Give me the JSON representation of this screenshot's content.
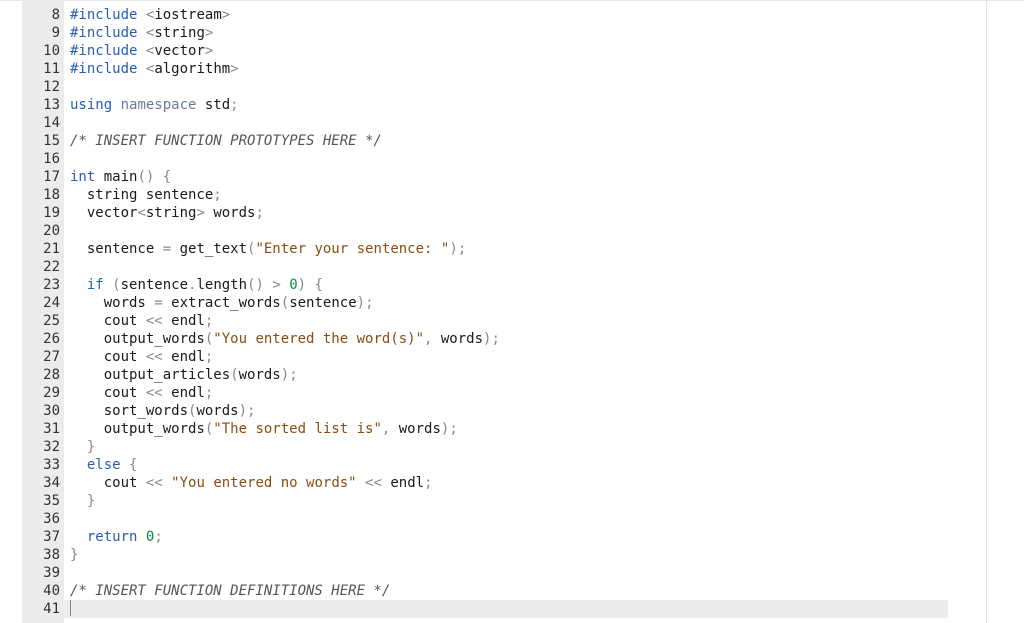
{
  "editor": {
    "lines": [
      {
        "n": "8",
        "t": "#include <iostream>"
      },
      {
        "n": "9",
        "t": "#include <string>"
      },
      {
        "n": "10",
        "t": "#include <vector>"
      },
      {
        "n": "11",
        "t": "#include <algorithm>"
      },
      {
        "n": "12",
        "t": ""
      },
      {
        "n": "13",
        "t": "using namespace std;"
      },
      {
        "n": "14",
        "t": ""
      },
      {
        "n": "15",
        "t": "/* INSERT FUNCTION PROTOTYPES HERE */"
      },
      {
        "n": "16",
        "t": ""
      },
      {
        "n": "17",
        "t": "int main() {"
      },
      {
        "n": "18",
        "t": "  string sentence;"
      },
      {
        "n": "19",
        "t": "  vector<string> words;"
      },
      {
        "n": "20",
        "t": ""
      },
      {
        "n": "21",
        "t": "  sentence = get_text(\"Enter your sentence: \");"
      },
      {
        "n": "22",
        "t": ""
      },
      {
        "n": "23",
        "t": "  if (sentence.length() > 0) {"
      },
      {
        "n": "24",
        "t": "    words = extract_words(sentence);"
      },
      {
        "n": "25",
        "t": "    cout << endl;"
      },
      {
        "n": "26",
        "t": "    output_words(\"You entered the word(s)\", words);"
      },
      {
        "n": "27",
        "t": "    cout << endl;"
      },
      {
        "n": "28",
        "t": "    output_articles(words);"
      },
      {
        "n": "29",
        "t": "    cout << endl;"
      },
      {
        "n": "30",
        "t": "    sort_words(words);"
      },
      {
        "n": "31",
        "t": "    output_words(\"The sorted list is\", words);"
      },
      {
        "n": "32",
        "t": "  }"
      },
      {
        "n": "33",
        "t": "  else {"
      },
      {
        "n": "34",
        "t": "    cout << \"You entered no words\" << endl;"
      },
      {
        "n": "35",
        "t": "  }"
      },
      {
        "n": "36",
        "t": ""
      },
      {
        "n": "37",
        "t": "  return 0;"
      },
      {
        "n": "38",
        "t": "}"
      },
      {
        "n": "39",
        "t": ""
      },
      {
        "n": "40",
        "t": "/* INSERT FUNCTION DEFINITIONS HERE */"
      },
      {
        "n": "41",
        "t": ""
      }
    ],
    "active_line": "41",
    "colors": {
      "keyword": "#2a5db0",
      "namespace": "#6a7c9a",
      "comment": "#555555",
      "string": "#8a4d0f",
      "number": "#0f8a4d",
      "operator": "#888888",
      "gutter": "#ececec"
    }
  }
}
